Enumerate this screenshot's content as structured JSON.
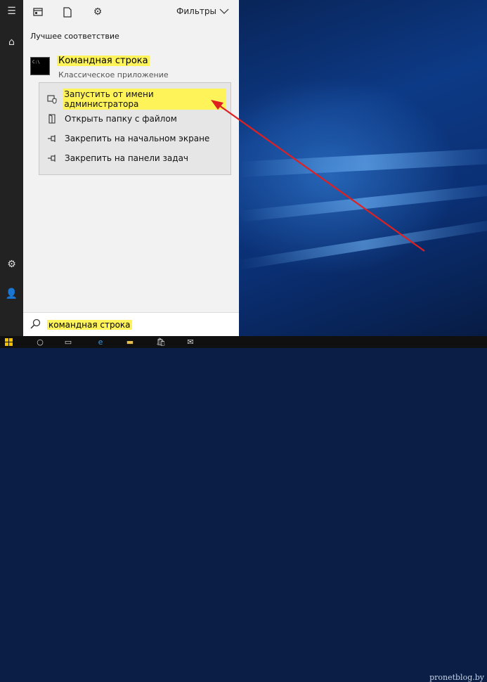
{
  "toolbar": {
    "filters_label": "Фильтры",
    "icons": [
      "apps-icon",
      "document-icon",
      "gear-icon"
    ]
  },
  "section_title": "Лучшее соответствие",
  "best_match": {
    "title": "Командная строка",
    "subtitle": "Классическое приложение"
  },
  "context_menu": {
    "items": [
      {
        "label": "Запустить от имени администратора",
        "icon": "shield-icon",
        "highlighted": true
      },
      {
        "label": "Открыть папку с файлом",
        "icon": "folder-open-icon",
        "highlighted": false
      },
      {
        "label": "Закрепить на начальном экране",
        "icon": "pin-icon",
        "highlighted": false
      },
      {
        "label": "Закрепить на панели задач",
        "icon": "pin-icon",
        "highlighted": false
      }
    ]
  },
  "search": {
    "query": "командная строка"
  },
  "watermark": "pronetblog.by",
  "colors": {
    "highlight": "#fff35a",
    "arrow": "#e02020",
    "panel": "#f2f2f2",
    "sidebar": "#222222"
  }
}
